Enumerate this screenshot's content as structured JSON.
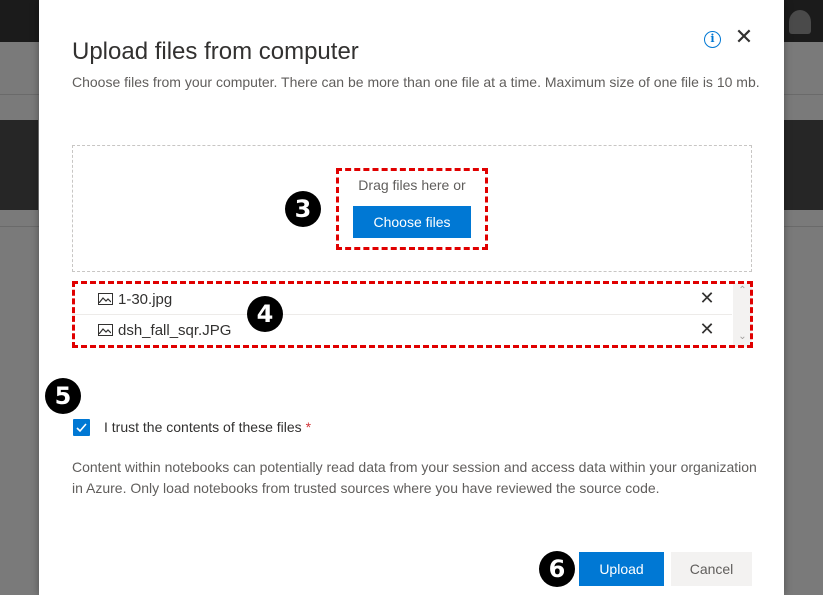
{
  "dialog": {
    "title": "Upload files from computer",
    "description": "Choose files from your computer. There can be more than one file at a time. Maximum size of one file is 10 mb.",
    "info_icon": "i",
    "close_icon": "✕"
  },
  "dropzone": {
    "drag_text": "Drag files here or",
    "choose_button": "Choose files"
  },
  "files": [
    {
      "name": "1-30.jpg",
      "remove": "✕"
    },
    {
      "name": "dsh_fall_sqr.JPG",
      "remove": "✕"
    }
  ],
  "scrollbar": {
    "up": "⌃",
    "down": "⌄"
  },
  "trust": {
    "checked": true,
    "label": "I trust the contents of these files",
    "required_mark": "*"
  },
  "warning": "Content within notebooks can potentially read data from your session and access data within your organization in Azure. Only load notebooks from trusted sources where you have reviewed the source code.",
  "footer": {
    "upload_button": "Upload",
    "cancel_button": "Cancel"
  },
  "annotations": {
    "badge_3": "3",
    "badge_4": "4",
    "badge_5": "5",
    "badge_6": "6"
  },
  "colors": {
    "accent": "#0078d4",
    "annotation": "#e00000",
    "required": "#d13438"
  }
}
